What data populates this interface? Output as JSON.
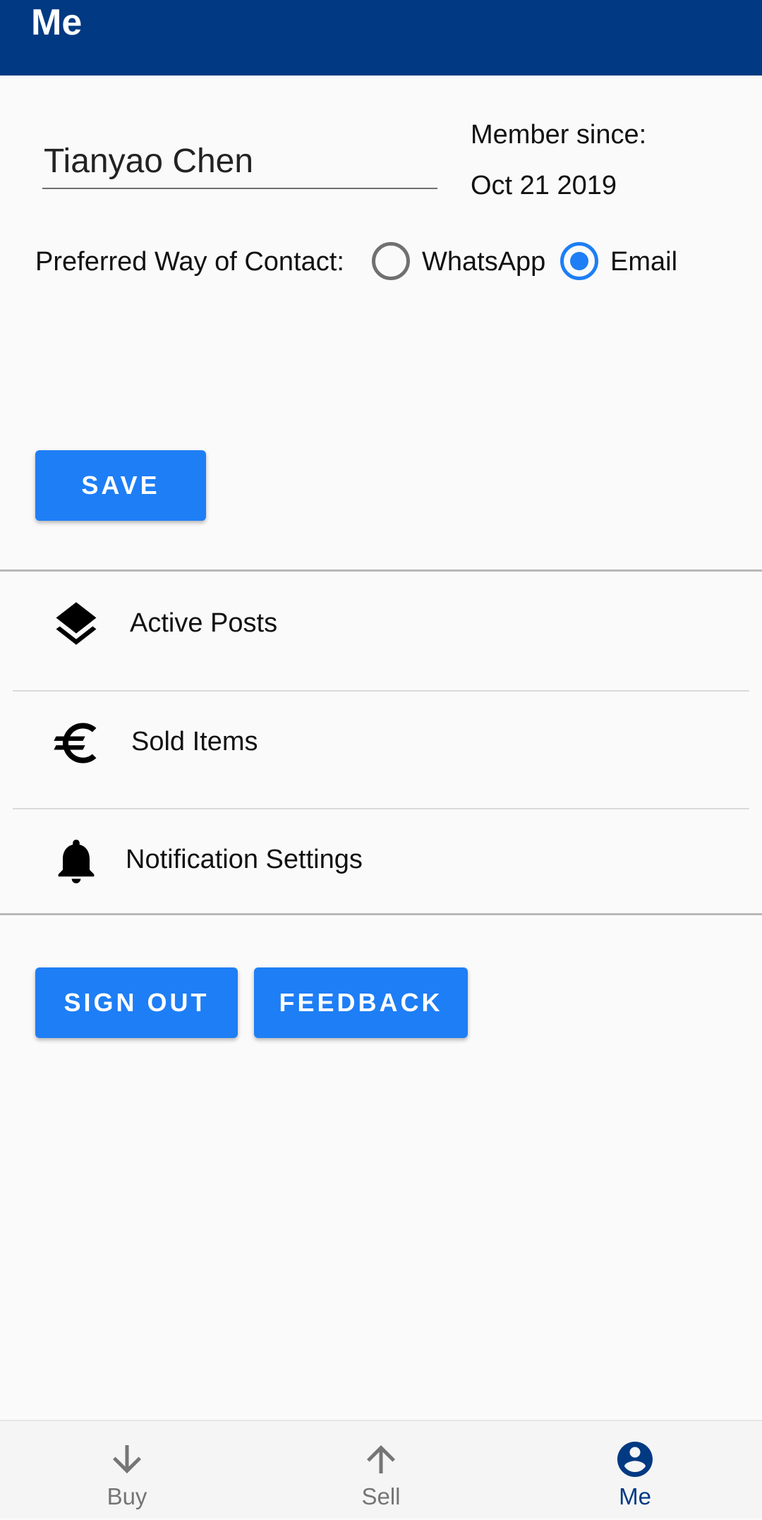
{
  "app_bar": {
    "title": "Me",
    "background": "#013a82"
  },
  "profile": {
    "name_value": "Tianyao Chen",
    "member_since_label": "Member since:",
    "member_since_date": "Oct 21 2019"
  },
  "contact": {
    "label": "Preferred Way of Contact:",
    "options": [
      {
        "label": "WhatsApp",
        "selected": false
      },
      {
        "label": "Email",
        "selected": true
      }
    ]
  },
  "buttons": {
    "save": "SAVE",
    "sign_out": "SIGN OUT",
    "feedback": "FEEDBACK",
    "color": "#1e7ef5"
  },
  "menu": {
    "items": [
      {
        "label": "Active Posts",
        "icon": "layers-icon"
      },
      {
        "label": "Sold Items",
        "icon": "euro-icon"
      },
      {
        "label": "Notification Settings",
        "icon": "bell-icon"
      }
    ]
  },
  "bottom_nav": {
    "items": [
      {
        "label": "Buy",
        "icon": "arrow-down-icon",
        "active": false
      },
      {
        "label": "Sell",
        "icon": "arrow-up-icon",
        "active": false
      },
      {
        "label": "Me",
        "icon": "account-icon",
        "active": true
      }
    ],
    "active_color": "#013a82"
  }
}
